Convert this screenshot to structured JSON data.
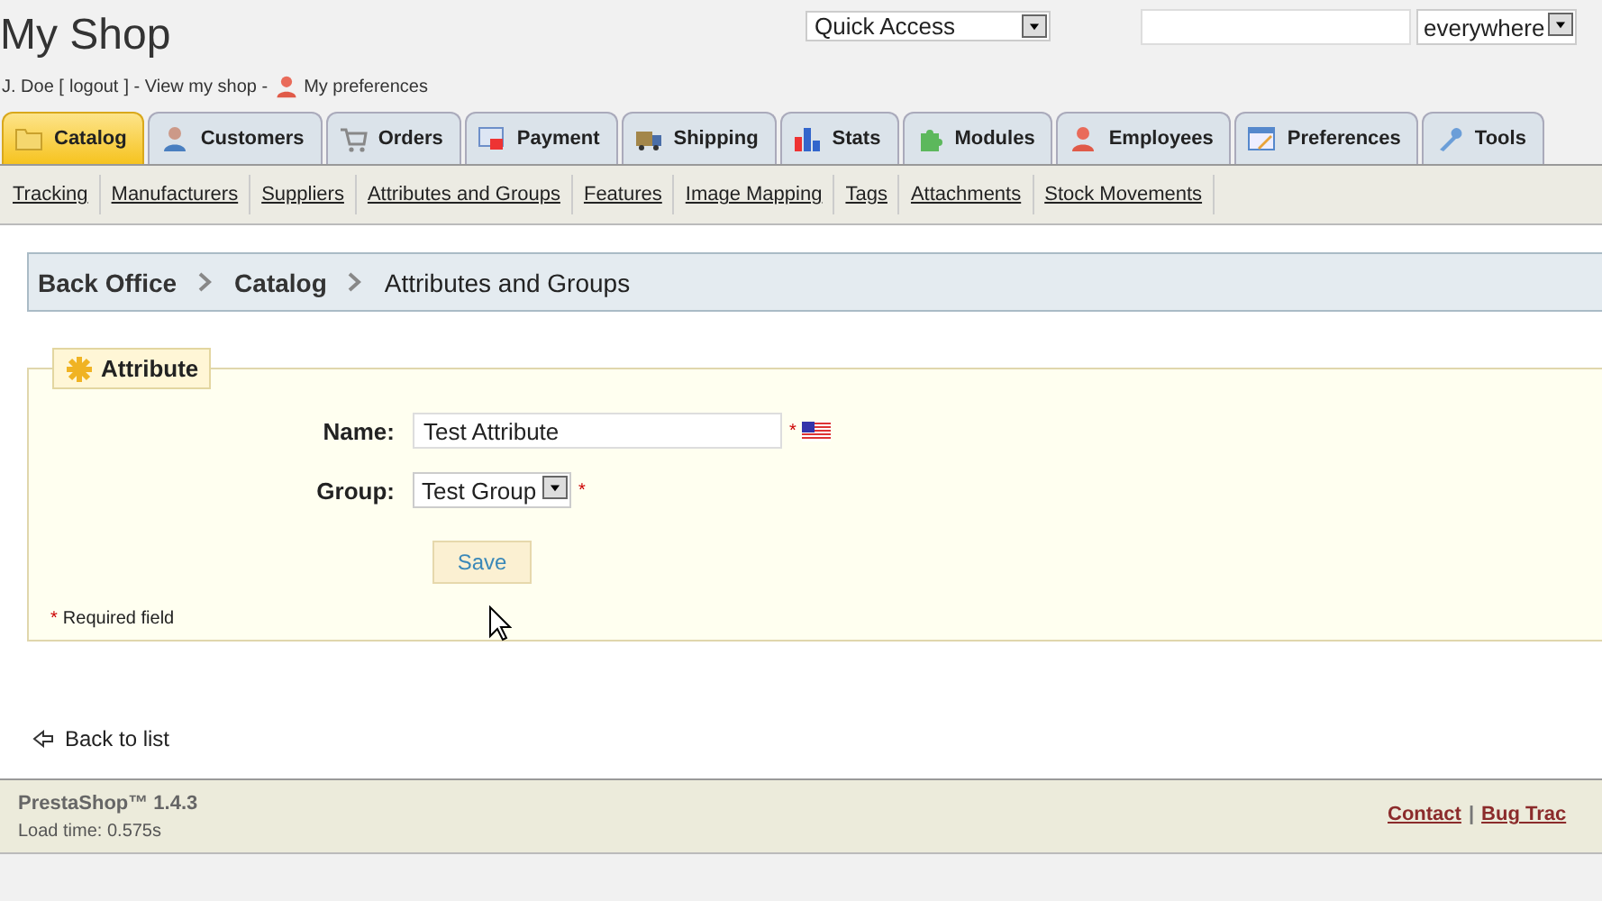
{
  "header": {
    "shop_name": "My Shop",
    "quick_access": "Quick Access",
    "search": {
      "scope": "everywhere"
    },
    "user": "J. Doe [",
    "logout": "logout",
    "user_after": "] - View my shop -",
    "preferences": "My preferences"
  },
  "tabs": [
    {
      "label": "Catalog",
      "selected": true
    },
    {
      "label": "Customers",
      "selected": false
    },
    {
      "label": "Orders",
      "selected": false
    },
    {
      "label": "Payment",
      "selected": false
    },
    {
      "label": "Shipping",
      "selected": false
    },
    {
      "label": "Stats",
      "selected": false
    },
    {
      "label": "Modules",
      "selected": false
    },
    {
      "label": "Employees",
      "selected": false
    },
    {
      "label": "Preferences",
      "selected": false
    },
    {
      "label": "Tools",
      "selected": false
    }
  ],
  "subtabs": [
    "Tracking",
    "Manufacturers",
    "Suppliers",
    "Attributes and Groups",
    "Features",
    "Image Mapping",
    "Tags",
    "Attachments",
    "Stock Movements"
  ],
  "breadcrumb": [
    "Back Office",
    "Catalog",
    "Attributes and Groups"
  ],
  "form": {
    "legend": "Attribute",
    "name_label": "Name:",
    "name_value": "Test Attribute",
    "group_label": "Group:",
    "group_value": "Test Group",
    "save": "Save",
    "required_mark": "*",
    "required_note": "Required field"
  },
  "back_link": "Back to list",
  "footer": {
    "version": "PrestaShop™ 1.4.3",
    "load_time": "Load time: 0.575s",
    "separator": "|",
    "links": [
      "Contact",
      "Bug Trac"
    ]
  }
}
